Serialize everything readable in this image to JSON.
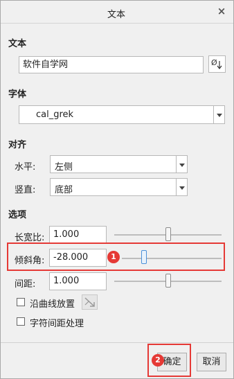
{
  "dialog": {
    "title": "文本",
    "close_glyph": "×"
  },
  "text_section": {
    "heading": "文本",
    "value": "软件自学网",
    "tool_icon": "insert-symbol-icon"
  },
  "font_section": {
    "heading": "字体",
    "value": "cal_grek"
  },
  "align_section": {
    "heading": "对齐",
    "horizontal_label": "水平:",
    "horizontal_value": "左侧",
    "vertical_label": "竖直:",
    "vertical_value": "底部"
  },
  "options_section": {
    "heading": "选项",
    "aspect_label": "长宽比:",
    "aspect_value": "1.000",
    "slant_label": "倾斜角:",
    "slant_value": "-28.000",
    "spacing_label": "间距:",
    "spacing_value": "1.000",
    "along_curve_label": "沿曲线放置",
    "along_curve_checked": false,
    "char_spacing_label": "字符间距处理",
    "char_spacing_checked": false
  },
  "annotations": {
    "badge1": "1",
    "badge2": "2",
    "highlight_color": "#e53935"
  },
  "buttons": {
    "ok": "确定",
    "cancel": "取消"
  }
}
